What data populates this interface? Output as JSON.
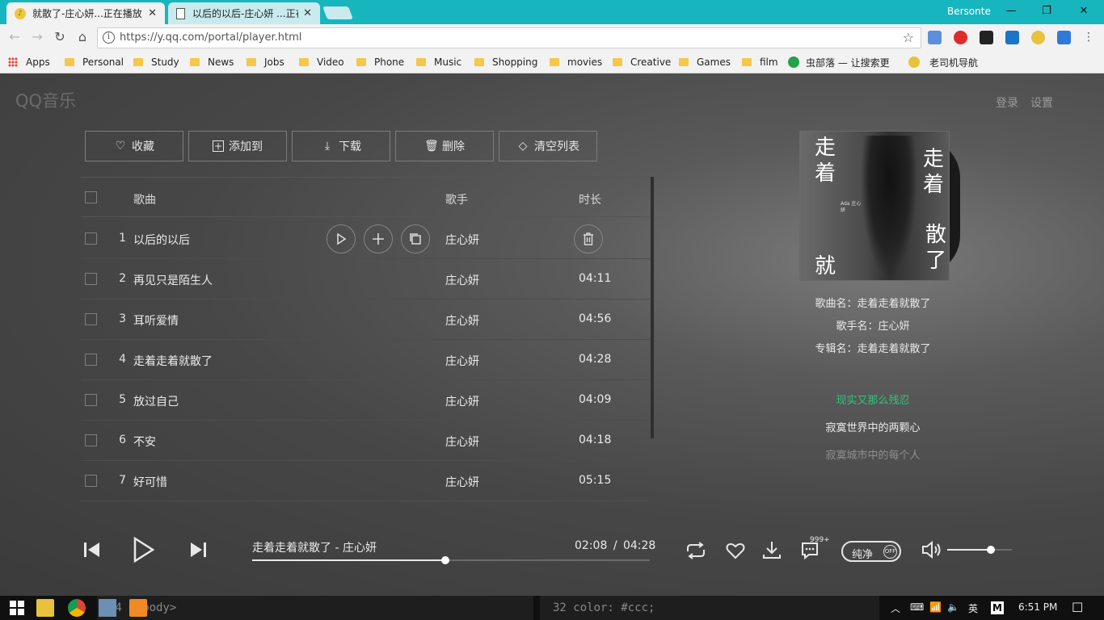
{
  "browser": {
    "tabs": [
      {
        "title": "就散了-庄心妍...正在播放",
        "active": true
      },
      {
        "title": "以后的以后-庄心妍 ...正在",
        "active": false
      }
    ],
    "user": "Bersonte",
    "url": "https://y.qq.com/portal/player.html",
    "bookmarks": [
      "Apps",
      "Personal",
      "Study",
      "News",
      "Jobs",
      "Video",
      "Phone",
      "Music",
      "Shopping",
      "movies",
      "Creative",
      "Games",
      "film",
      "虫部落 — 让搜索更",
      "老司机导航"
    ]
  },
  "player": {
    "logo": "QQ音乐",
    "login": "登录",
    "settings": "设置",
    "actions": {
      "favorite": "收藏",
      "add_to": "添加到",
      "download": "下载",
      "delete": "删除",
      "clear": "清空列表"
    },
    "columns": {
      "song": "歌曲",
      "singer": "歌手",
      "duration": "时长"
    },
    "songs": [
      {
        "num": "1",
        "title": "以后的以后",
        "singer": "庄心妍",
        "duration": ""
      },
      {
        "num": "2",
        "title": "再见只是陌生人",
        "singer": "庄心妍",
        "duration": "04:11"
      },
      {
        "num": "3",
        "title": "耳听爱情",
        "singer": "庄心妍",
        "duration": "04:56"
      },
      {
        "num": "4",
        "title": "走着走着就散了",
        "singer": "庄心妍",
        "duration": "04:28"
      },
      {
        "num": "5",
        "title": "放过自己",
        "singer": "庄心妍",
        "duration": "04:09"
      },
      {
        "num": "6",
        "title": "不安",
        "singer": "庄心妍",
        "duration": "04:18"
      },
      {
        "num": "7",
        "title": "好可惜",
        "singer": "庄心妍",
        "duration": "05:15"
      }
    ],
    "cover_text": {
      "left_top": "走着",
      "right_top": "走着",
      "left_bottom": "就",
      "right_bottom": "散了",
      "small": "Ada 庄心妍"
    },
    "info": {
      "song_name": "歌曲名：走着走着就散了",
      "singer_name": "歌手名：庄心妍",
      "album_name": "专辑名：走着走着就散了"
    },
    "lyrics": [
      "现实又那么残忍",
      "寂寞世界中的两颗心",
      "寂寞城市中的每个人"
    ],
    "lyric_active_color": "#31c27c",
    "now_playing": "走着走着就散了 - 庄心妍",
    "current_time": "02:08",
    "total_time": "04:28",
    "progress_fraction": 0.485,
    "comment_count": "999+",
    "pure_label": "纯净",
    "pure_state": "OFF",
    "volume_fraction": 0.68
  },
  "taskbar": {
    "code_left": "64    </body>",
    "code_right": "32    color: #ccc;",
    "lang": "英",
    "time": "6:51 PM"
  }
}
